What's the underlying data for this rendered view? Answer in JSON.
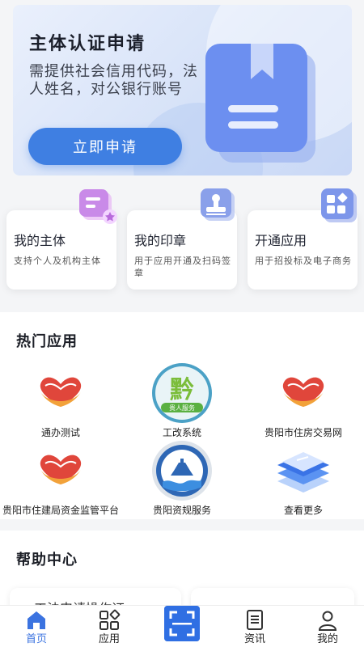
{
  "banner": {
    "title": "主体认证申请",
    "desc": "需提供社会信用代码，法人姓名，对公银行账号",
    "button": "立即申请",
    "icon": "bookmark-book-icon"
  },
  "cards": [
    {
      "title": "我的主体",
      "desc": "支持个人及机构主体",
      "icon": "profile-card-icon"
    },
    {
      "title": "我的印章",
      "desc": "用于应用开通及扫码签章",
      "icon": "seal-stamp-icon"
    },
    {
      "title": "开通应用",
      "desc": "用于招投标及电子商务",
      "icon": "apps-grid-icon"
    }
  ],
  "hot": {
    "title": "热门应用",
    "apps": [
      {
        "label": "通办测试",
        "icon": "red-heart-hands-icon"
      },
      {
        "label": "工改系统",
        "icon": "qian-logo-icon",
        "badge": "贵人服务"
      },
      {
        "label": "贵阳市住房交易网",
        "icon": "red-heart-hands-icon"
      },
      {
        "label": "贵阳市住建局资金监管平台",
        "icon": "red-heart-hands-icon"
      },
      {
        "label": "贵阳资规服务",
        "icon": "pagoda-wave-icon"
      },
      {
        "label": "查看更多",
        "icon": "layers-stack-icon"
      }
    ]
  },
  "help": {
    "title": "帮助中心",
    "items": [
      {
        "label": "工法申请操作证"
      },
      {
        "label": ""
      }
    ]
  },
  "nav": [
    {
      "label": "首页",
      "icon": "home-icon",
      "active": true
    },
    {
      "label": "应用",
      "icon": "apps-icon"
    },
    {
      "label": "",
      "icon": "scan-icon"
    },
    {
      "label": "资讯",
      "icon": "news-icon"
    },
    {
      "label": "我的",
      "icon": "user-icon"
    }
  ],
  "colors": {
    "accent": "#3f7fe2",
    "nav_active": "#3b73e0",
    "heart_red": "#e0463b"
  }
}
